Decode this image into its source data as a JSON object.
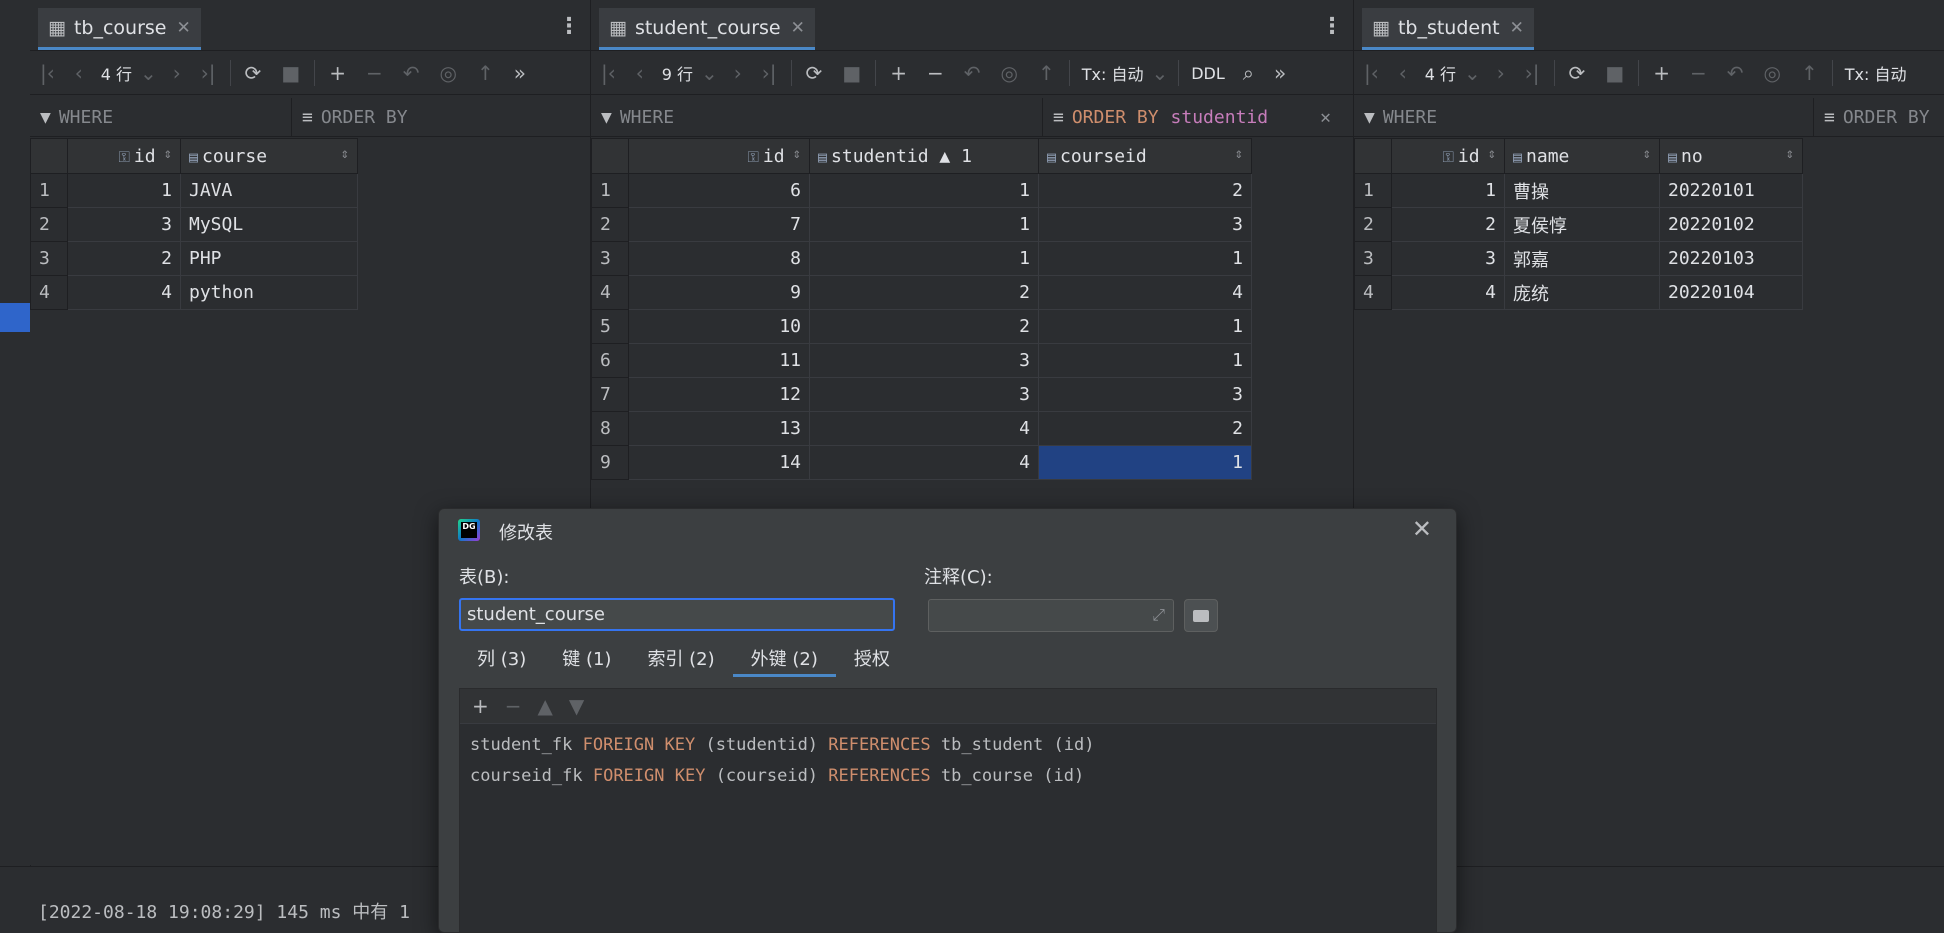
{
  "panels": [
    {
      "tab": "tb_course",
      "rows_label": "4 行",
      "filter_where": "WHERE",
      "filter_order": "ORDER BY",
      "columns": [
        "id",
        "course"
      ],
      "rows": [
        [
          "1",
          "1",
          "JAVA"
        ],
        [
          "2",
          "3",
          "MySQL"
        ],
        [
          "3",
          "2",
          "PHP"
        ],
        [
          "4",
          "4",
          "python"
        ]
      ]
    },
    {
      "tab": "student_course",
      "rows_label": "9 行",
      "tx_label": "Tx: 自动",
      "ddl_label": "DDL",
      "filter_where": "WHERE",
      "filter_order_key": "ORDER BY",
      "filter_order_col": "studentid",
      "columns": [
        "id",
        "studentid",
        "courseid"
      ],
      "sort_badge": "▲ 1",
      "rows": [
        [
          "1",
          "6",
          "1",
          "2"
        ],
        [
          "2",
          "7",
          "1",
          "3"
        ],
        [
          "3",
          "8",
          "1",
          "1"
        ],
        [
          "4",
          "9",
          "2",
          "4"
        ],
        [
          "5",
          "10",
          "2",
          "1"
        ],
        [
          "6",
          "11",
          "3",
          "1"
        ],
        [
          "7",
          "12",
          "3",
          "3"
        ],
        [
          "8",
          "13",
          "4",
          "2"
        ],
        [
          "9",
          "14",
          "4",
          "1"
        ]
      ]
    },
    {
      "tab": "tb_student",
      "rows_label": "4 行",
      "tx_label": "Tx: 自动",
      "filter_where": "WHERE",
      "filter_order": "ORDER BY",
      "columns": [
        "id",
        "name",
        "no"
      ],
      "rows": [
        [
          "1",
          "1",
          "曹操",
          "20220101"
        ],
        [
          "2",
          "2",
          "夏侯惇",
          "20220102"
        ],
        [
          "3",
          "3",
          "郭嘉",
          "20220103"
        ],
        [
          "4",
          "4",
          "庞统",
          "20220104"
        ]
      ]
    }
  ],
  "log": "[2022-08-18 19:08:29] 145 ms 中有 1",
  "dialog": {
    "title": "修改表",
    "table_label": "表(B):",
    "table_value": "student_course",
    "comment_label": "注释(C):",
    "tabs": [
      "列 (3)",
      "键 (1)",
      "索引 (2)",
      "外键 (2)",
      "授权"
    ],
    "active_tab": "外键 (2)",
    "fk": [
      {
        "name": "student_fk",
        "kw1": "FOREIGN KEY",
        "col": "(studentid)",
        "kw2": "REFERENCES",
        "ref": "tb_student (id)"
      },
      {
        "name": "courseid_fk",
        "kw1": "FOREIGN KEY",
        "col": "(courseid)",
        "kw2": "REFERENCES",
        "ref": "tb_course (id)"
      }
    ]
  },
  "colors": {
    "accent": "#4a88c7",
    "selection": "#214283",
    "keyword": "#cf8e6d",
    "column": "#c77dbb"
  }
}
